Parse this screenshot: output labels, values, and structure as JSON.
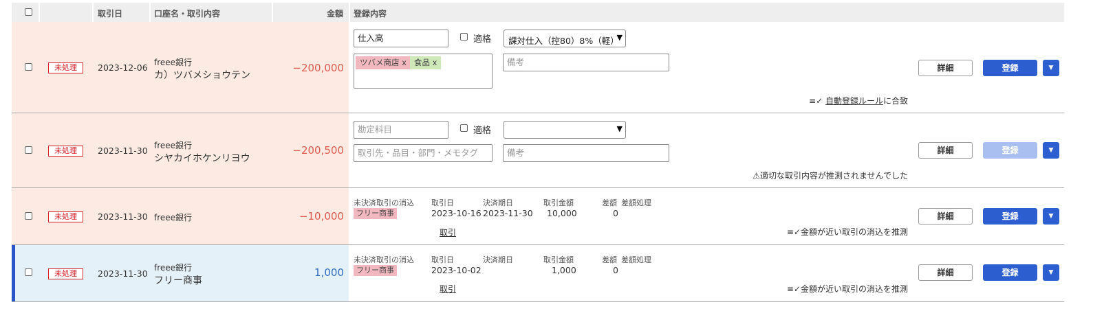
{
  "header": {
    "date": "取引日",
    "account": "口座名・取引内容",
    "amount": "金額",
    "registration": "登録内容"
  },
  "rows": [
    {
      "status": "未処理",
      "date": "2023-12-06",
      "bank": "freee銀行",
      "desc": "カ）ツバメショウテン",
      "amount": "−200,000",
      "account_item": "仕入高",
      "eligible_label": "適格",
      "tax": "課対仕入（控80）8%（軽）",
      "tags": [
        "ツバメ商店 x",
        "食品 x"
      ],
      "memo_placeholder": "備考",
      "detail_label": "詳細",
      "register_label": "登録",
      "note_link": "自動登録ルール",
      "note_suffix": "に合致"
    },
    {
      "status": "未処理",
      "date": "2023-11-30",
      "bank": "freee銀行",
      "desc": "シヤカイホケンリヨウ",
      "amount": "−200,500",
      "account_placeholder": "勘定科目",
      "eligible_label": "適格",
      "tax": "",
      "tags_placeholder": "取引先・品目・部門・メモタグ",
      "memo_placeholder": "備考",
      "detail_label": "詳細",
      "register_label": "登録",
      "note": "適切な取引内容が推測されませんでした"
    },
    {
      "status": "未処理",
      "date": "2023-11-30",
      "bank": "freee銀行",
      "desc": "",
      "amount": "−10,000",
      "clear_label": "未決済取引の消込",
      "partner": "フリー商事",
      "col_date": "取引日",
      "col_due": "決済期日",
      "col_amount": "取引金額",
      "col_diff": "差額",
      "col_diff_proc": "差額処理",
      "txn_date": "2023-10-16",
      "due_date": "2023-11-30",
      "txn_amount": "10,000",
      "diff": "0",
      "txn_link": "取引",
      "detail_label": "詳細",
      "register_label": "登録",
      "note": "金額が近い取引の消込を推測"
    },
    {
      "status": "未処理",
      "date": "2023-11-30",
      "bank": "freee銀行",
      "desc": "フリー商事",
      "amount": "1,000",
      "clear_label": "未決済取引の消込",
      "partner": "フリー商事",
      "col_date": "取引日",
      "col_due": "決済期日",
      "col_amount": "取引金額",
      "col_diff": "差額",
      "col_diff_proc": "差額処理",
      "txn_date": "2023-10-02",
      "due_date": "",
      "txn_amount": "1,000",
      "diff": "0",
      "txn_link": "取引",
      "detail_label": "詳細",
      "register_label": "登録",
      "note": "金額が近い取引の消込を推測"
    }
  ]
}
